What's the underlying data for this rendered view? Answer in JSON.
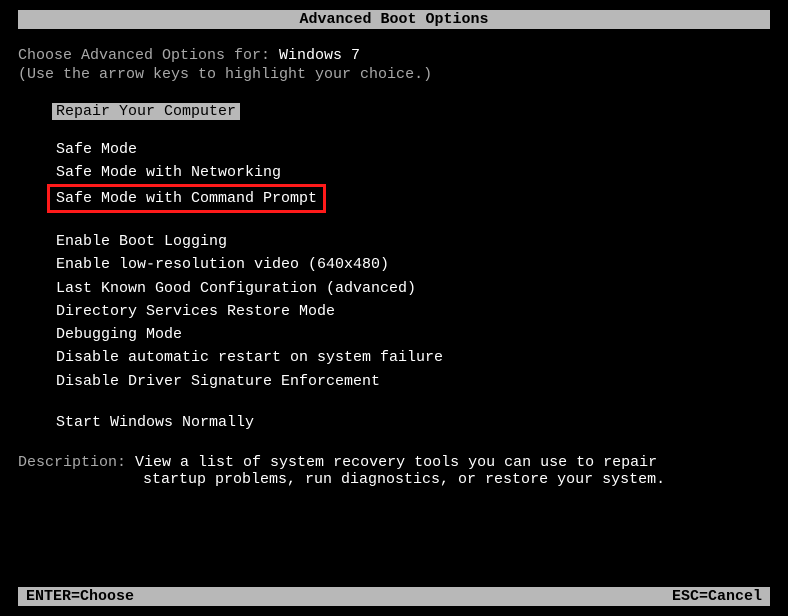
{
  "title": "Advanced Boot Options",
  "prompt": {
    "prefix": "Choose Advanced Options for: ",
    "os": "Windows 7"
  },
  "hint": "(Use the arrow keys to highlight your choice.)",
  "selected": "Repair Your Computer",
  "group1": {
    "item0": "Safe Mode",
    "item1": "Safe Mode with Networking",
    "item2": "Safe Mode with Command Prompt"
  },
  "group2": {
    "item0": "Enable Boot Logging",
    "item1": "Enable low-resolution video (640x480)",
    "item2": "Last Known Good Configuration (advanced)",
    "item3": "Directory Services Restore Mode",
    "item4": "Debugging Mode",
    "item5": "Disable automatic restart on system failure",
    "item6": "Disable Driver Signature Enforcement"
  },
  "group3": {
    "item0": "Start Windows Normally"
  },
  "description": {
    "label": "Description: ",
    "line1": "View a list of system recovery tools you can use to repair",
    "line2": "startup problems, run diagnostics, or restore your system."
  },
  "footer": {
    "left": "ENTER=Choose",
    "right": "ESC=Cancel"
  }
}
